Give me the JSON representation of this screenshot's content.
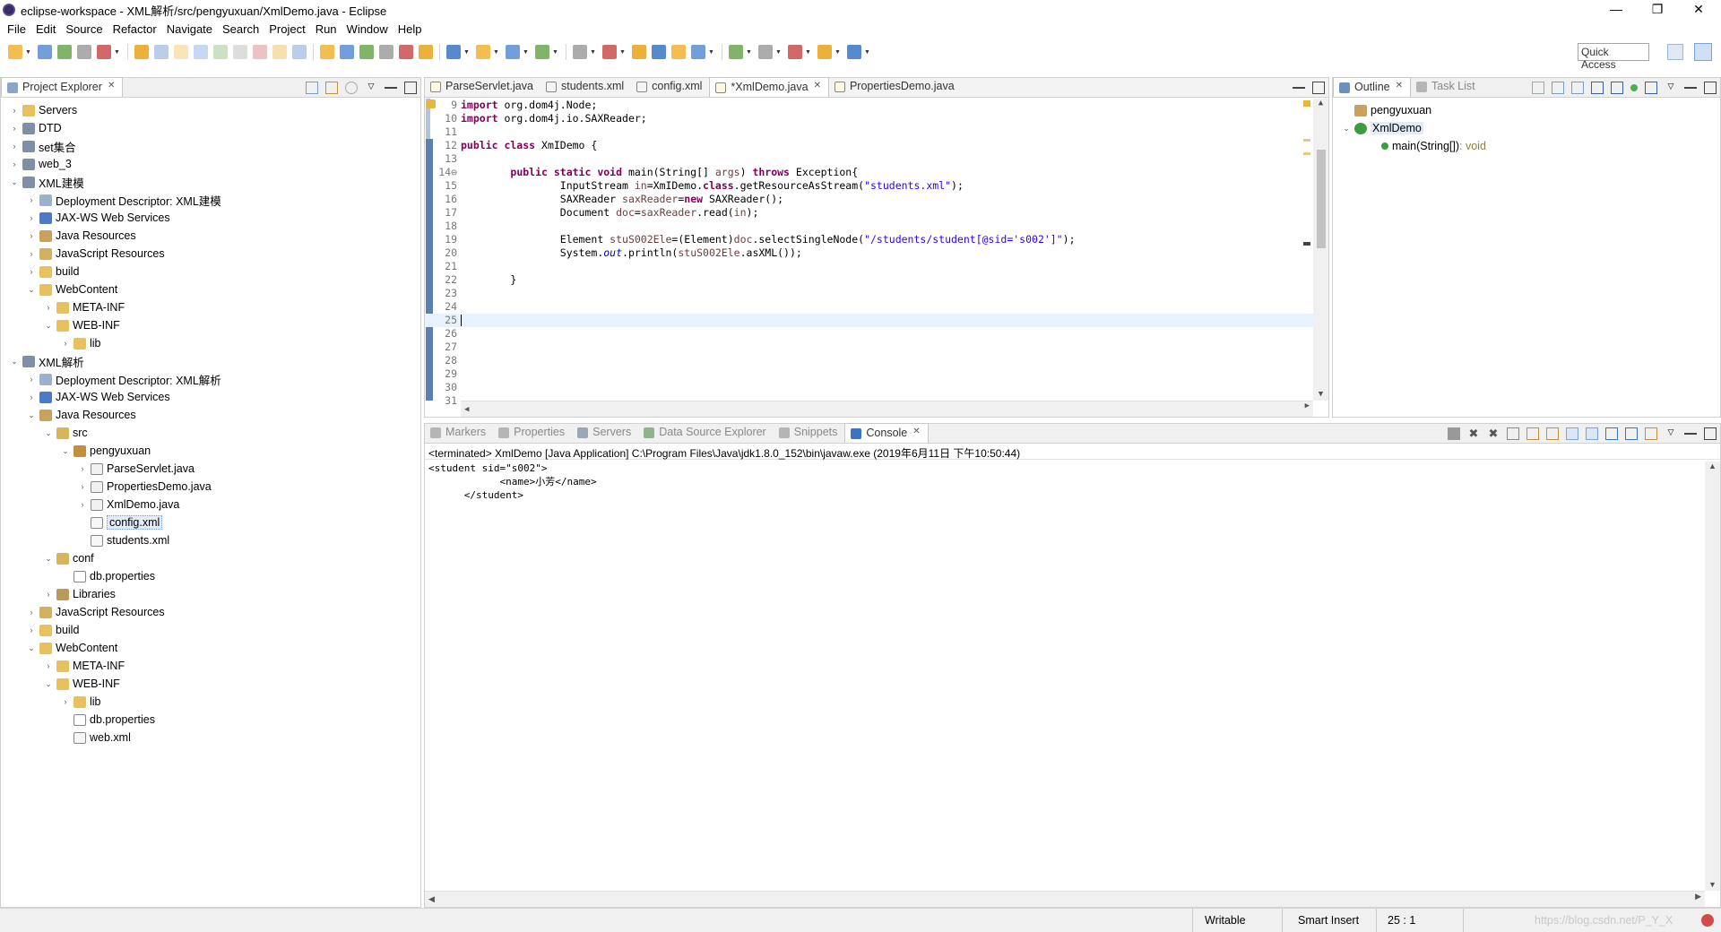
{
  "window": {
    "title": "eclipse-workspace - XML解析/src/pengyuxuan/XmlDemo.java - Eclipse",
    "minimize": "—",
    "restore": "❐",
    "close": "✕"
  },
  "menu": [
    "File",
    "Edit",
    "Source",
    "Refactor",
    "Navigate",
    "Search",
    "Project",
    "Run",
    "Window",
    "Help"
  ],
  "toolbar": {
    "quick_access": "Quick Access",
    "colors": [
      "#f2b134",
      "#5b8dd6",
      "#6aa84f",
      "#9e9e9e",
      "#c94f4f",
      "#e8a317",
      "#3a74c4"
    ]
  },
  "explorer": {
    "tab_label": "Project Explorer",
    "items": [
      {
        "label": "Servers",
        "depth": 0,
        "arrow": "›",
        "icon": "folder"
      },
      {
        "label": "DTD",
        "depth": 0,
        "arrow": "›",
        "icon": "project"
      },
      {
        "label": "set集合",
        "depth": 0,
        "arrow": "›",
        "icon": "project"
      },
      {
        "label": "web_3",
        "depth": 0,
        "arrow": "›",
        "icon": "project"
      },
      {
        "label": "XML建模",
        "depth": 0,
        "arrow": "⌄",
        "icon": "project"
      },
      {
        "label": "Deployment Descriptor: XML建模",
        "depth": 1,
        "arrow": "›",
        "icon": "descriptor"
      },
      {
        "label": "JAX-WS Web Services",
        "depth": 1,
        "arrow": "›",
        "icon": "webservice"
      },
      {
        "label": "Java Resources",
        "depth": 1,
        "arrow": "›",
        "icon": "javares"
      },
      {
        "label": "JavaScript Resources",
        "depth": 1,
        "arrow": "›",
        "icon": "jsres"
      },
      {
        "label": "build",
        "depth": 1,
        "arrow": "›",
        "icon": "folder"
      },
      {
        "label": "WebContent",
        "depth": 1,
        "arrow": "⌄",
        "icon": "folder"
      },
      {
        "label": "META-INF",
        "depth": 2,
        "arrow": "›",
        "icon": "folder"
      },
      {
        "label": "WEB-INF",
        "depth": 2,
        "arrow": "⌄",
        "icon": "folder"
      },
      {
        "label": "lib",
        "depth": 3,
        "arrow": "›",
        "icon": "folder"
      },
      {
        "label": "XML解析",
        "depth": 0,
        "arrow": "⌄",
        "icon": "project"
      },
      {
        "label": "Deployment Descriptor: XML解析",
        "depth": 1,
        "arrow": "›",
        "icon": "descriptor"
      },
      {
        "label": "JAX-WS Web Services",
        "depth": 1,
        "arrow": "›",
        "icon": "webservice"
      },
      {
        "label": "Java Resources",
        "depth": 1,
        "arrow": "⌄",
        "icon": "javares"
      },
      {
        "label": "src",
        "depth": 2,
        "arrow": "⌄",
        "icon": "srcfolder"
      },
      {
        "label": "pengyuxuan",
        "depth": 3,
        "arrow": "⌄",
        "icon": "package"
      },
      {
        "label": "ParseServlet.java",
        "depth": 4,
        "arrow": "›",
        "icon": "javafile"
      },
      {
        "label": "PropertiesDemo.java",
        "depth": 4,
        "arrow": "›",
        "icon": "javafile"
      },
      {
        "label": "XmlDemo.java",
        "depth": 4,
        "arrow": "›",
        "icon": "javafile"
      },
      {
        "label": "config.xml",
        "depth": 4,
        "arrow": "",
        "icon": "xmlfile",
        "selected": true
      },
      {
        "label": "students.xml",
        "depth": 4,
        "arrow": "",
        "icon": "xmlfile"
      },
      {
        "label": "conf",
        "depth": 2,
        "arrow": "⌄",
        "icon": "srcfolder"
      },
      {
        "label": "db.properties",
        "depth": 3,
        "arrow": "",
        "icon": "file"
      },
      {
        "label": "Libraries",
        "depth": 2,
        "arrow": "›",
        "icon": "library"
      },
      {
        "label": "JavaScript Resources",
        "depth": 1,
        "arrow": "›",
        "icon": "jsres"
      },
      {
        "label": "build",
        "depth": 1,
        "arrow": "›",
        "icon": "folder"
      },
      {
        "label": "WebContent",
        "depth": 1,
        "arrow": "⌄",
        "icon": "folder"
      },
      {
        "label": "META-INF",
        "depth": 2,
        "arrow": "›",
        "icon": "folder"
      },
      {
        "label": "WEB-INF",
        "depth": 2,
        "arrow": "⌄",
        "icon": "folder"
      },
      {
        "label": "lib",
        "depth": 3,
        "arrow": "›",
        "icon": "folder"
      },
      {
        "label": "db.properties",
        "depth": 3,
        "arrow": "",
        "icon": "file"
      },
      {
        "label": "web.xml",
        "depth": 3,
        "arrow": "",
        "icon": "xmlfile"
      }
    ]
  },
  "editor": {
    "tabs": [
      {
        "label": "ParseServlet.java",
        "icon": "javafile",
        "active": false
      },
      {
        "label": "students.xml",
        "icon": "xmlfile",
        "active": false
      },
      {
        "label": "config.xml",
        "icon": "xmlfile",
        "active": false
      },
      {
        "label": "*XmlDemo.java",
        "icon": "javafile",
        "active": true
      },
      {
        "label": "PropertiesDemo.java",
        "icon": "javafile",
        "active": false
      }
    ],
    "current_line": 25,
    "lines": [
      {
        "n": "9",
        "html": "<span class=\"kw\">import</span> org.dom4j.Node;"
      },
      {
        "n": "10",
        "html": "<span class=\"kw\">import</span> org.dom4j.io.SAXReader;"
      },
      {
        "n": "11",
        "html": ""
      },
      {
        "n": "12",
        "html": "<span class=\"kw\">public class</span> XmIDemo {"
      },
      {
        "n": "13",
        "html": ""
      },
      {
        "n": "14⊖",
        "html": "        <span class=\"kw\">public static void</span> main(String[] <span class=\"var\">args</span>) <span class=\"kw\">throws</span> Exception{"
      },
      {
        "n": "15",
        "html": "                InputStream <span class=\"var\">in</span>=XmIDemo.<span class=\"kw\">class</span>.getResourceAsStream(<span class=\"str\">\"students.xml\"</span>);"
      },
      {
        "n": "16",
        "html": "                SAXReader <span class=\"var\">saxReader</span>=<span class=\"kw\">new</span> SAXReader();"
      },
      {
        "n": "17",
        "html": "                Document <span class=\"var\">doc</span>=<span class=\"var\">saxReader</span>.read(<span class=\"var\">in</span>);"
      },
      {
        "n": "18",
        "html": ""
      },
      {
        "n": "19",
        "html": "                Element <span class=\"var\">stuS002Ele</span>=(Element)<span class=\"var\">doc</span>.selectSingleNode(<span class=\"str\">\"/students/student[@sid='s002']\"</span>);"
      },
      {
        "n": "20",
        "html": "                System.<span class=\"fld\">out</span>.println(<span class=\"var\">stuS002Ele</span>.asXML());"
      },
      {
        "n": "21",
        "html": ""
      },
      {
        "n": "22",
        "html": "        }"
      },
      {
        "n": "23",
        "html": ""
      },
      {
        "n": "24",
        "html": ""
      },
      {
        "n": "25",
        "html": ""
      },
      {
        "n": "26",
        "html": ""
      },
      {
        "n": "27",
        "html": ""
      },
      {
        "n": "28",
        "html": ""
      },
      {
        "n": "29",
        "html": ""
      },
      {
        "n": "30",
        "html": ""
      },
      {
        "n": "31",
        "html": ""
      }
    ]
  },
  "outline": {
    "tabs": [
      {
        "label": "Outline",
        "active": true
      },
      {
        "label": "Task List",
        "active": false
      }
    ],
    "items": [
      {
        "label": "pengyuxuan",
        "type": ""
      },
      {
        "label": "XmlDemo",
        "type": ""
      },
      {
        "label": "main(String[])",
        "type": " : void"
      }
    ]
  },
  "console": {
    "tabs": [
      {
        "label": "Markers",
        "active": false
      },
      {
        "label": "Properties",
        "active": false
      },
      {
        "label": "Servers",
        "active": false
      },
      {
        "label": "Data Source Explorer",
        "active": false
      },
      {
        "label": "Snippets",
        "active": false
      },
      {
        "label": "Console",
        "active": true
      }
    ],
    "process": "<terminated> XmlDemo [Java Application] C:\\Program Files\\Java\\jdk1.8.0_152\\bin\\javaw.exe (2019年6月11日 下午10:50:44)",
    "output": "<student sid=\"s002\">\n            <name>小芳</name>\n      </student>"
  },
  "status": {
    "writable": "Writable",
    "insert_mode": "Smart Insert",
    "position": "25 : 1",
    "watermark": "https://blog.csdn.net/P_Y_X"
  }
}
